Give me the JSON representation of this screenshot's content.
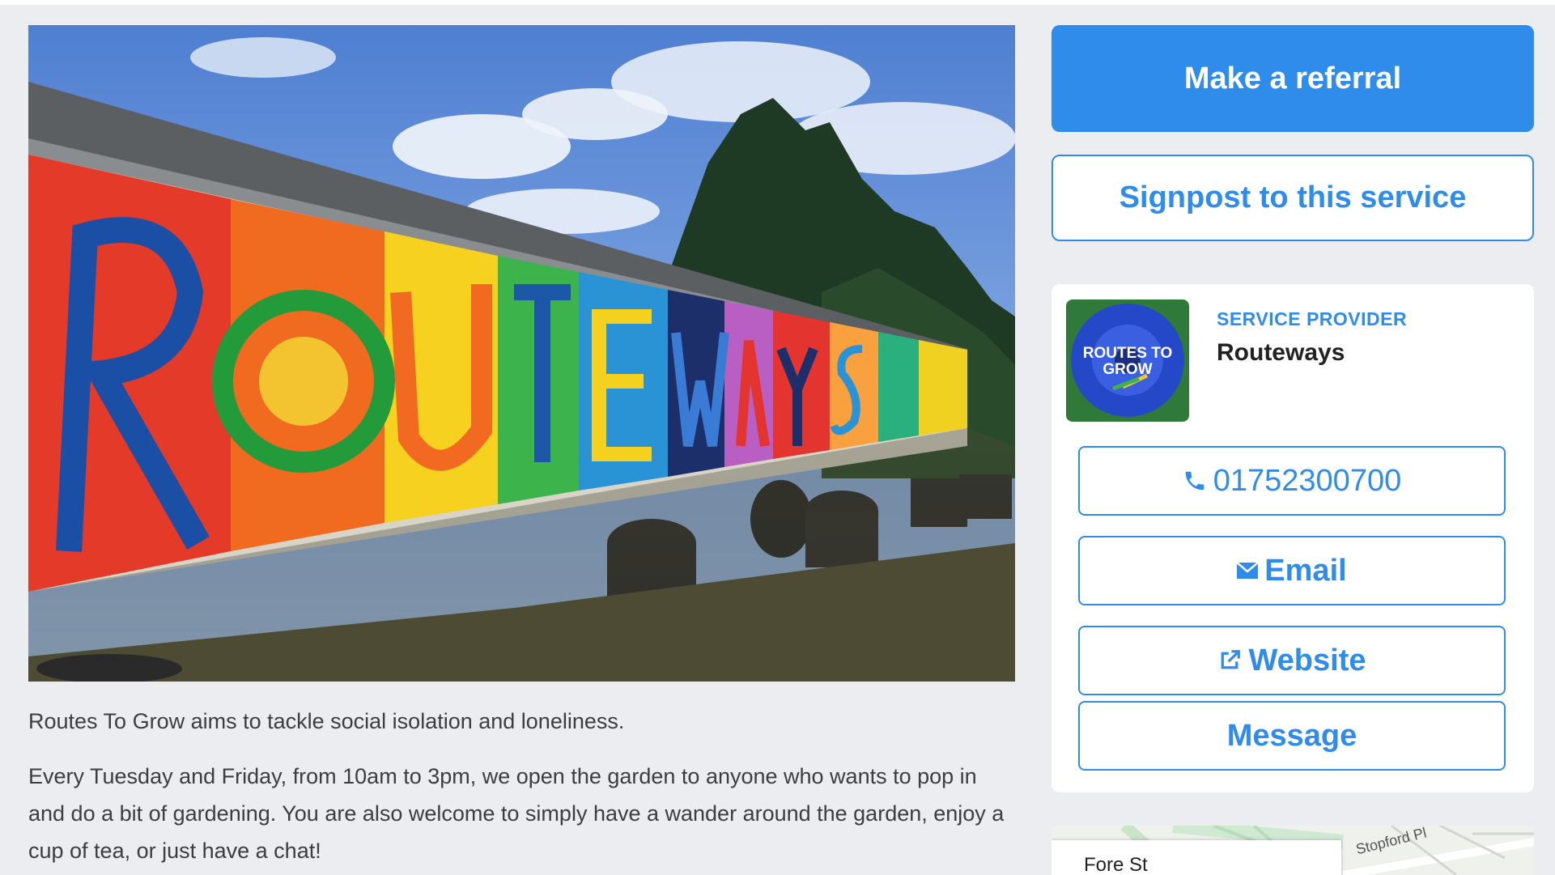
{
  "actions": {
    "referral_label": "Make a referral",
    "signpost_label": "Signpost to this service"
  },
  "provider": {
    "kicker": "SERVICE PROVIDER",
    "name": "Routeways",
    "logo_text_line1": "ROUTES TO",
    "logo_text_line2": "GROW",
    "phone_label": "01752300700",
    "email_label": "Email",
    "website_label": "Website",
    "message_label": "Message"
  },
  "hero": {
    "mural_text": "ROUTEWAYS"
  },
  "description": {
    "paragraph1": "Routes To Grow aims to tackle social isolation and loneliness.",
    "paragraph2": "Every Tuesday and Friday, from 10am to 3pm, we open the garden to anyone who wants to pop in and do a bit of gardening. You are also welcome to simply have a wander around the garden, enjoy a cup of tea, or just have a chat!"
  },
  "map": {
    "street1": "Fore St",
    "street2": "Stopford Pl"
  },
  "colors": {
    "accent": "#2f8cea",
    "background": "#ebedf1"
  },
  "icons": [
    "phone-icon",
    "email-icon",
    "external-link-icon"
  ]
}
